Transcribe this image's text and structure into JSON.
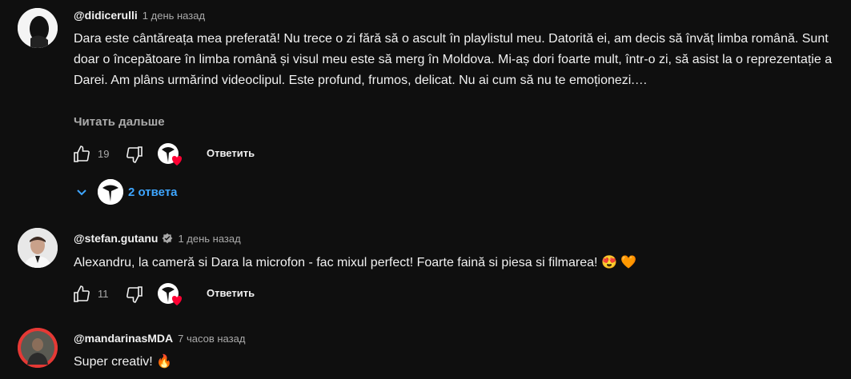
{
  "comments": [
    {
      "author": "@didicerulli",
      "time": "1 день назад",
      "text": "Dara este cântăreața mea preferată! Nu trece o zi fără să o ascult în playlistul meu. Datorită ei, am decis să învăț limba română. Sunt doar o începătoare în limba română și visul meu este să merg în Moldova. Mi-aș dori foarte mult, într-o zi, să asist la o reprezentație a Darei. Am plâns urmărind videoclipul. Este profund, frumos, delicat. Nu ai cum să nu te emoționezi.…",
      "read_more": "Читать дальше",
      "likes": "19",
      "reply_label": "Ответить",
      "replies_label": "2 ответа"
    },
    {
      "author": "@stefan.gutanu",
      "time": "1 день назад",
      "text": "Alexandru, la cameră si Dara la microfon - fac mixul perfect! Foarte faină si piesa si filmarea!",
      "emojis": [
        "😍",
        "🧡"
      ],
      "likes": "11",
      "reply_label": "Ответить"
    },
    {
      "author": "@mandarinasMDA",
      "time": "7 часов назад",
      "text": "Super creativ!",
      "emojis": [
        "🔥"
      ]
    }
  ],
  "icons": {
    "like": "thumb-up-icon",
    "dislike": "thumb-down-icon",
    "heart": "creator-heart-icon",
    "expand": "chevron-down-icon",
    "verified": "verified-badge-icon"
  },
  "colors": {
    "background": "#0f0f0f",
    "link": "#3ea6ff",
    "heart": "#ff0033",
    "secondary_text": "#aaaaaa"
  }
}
